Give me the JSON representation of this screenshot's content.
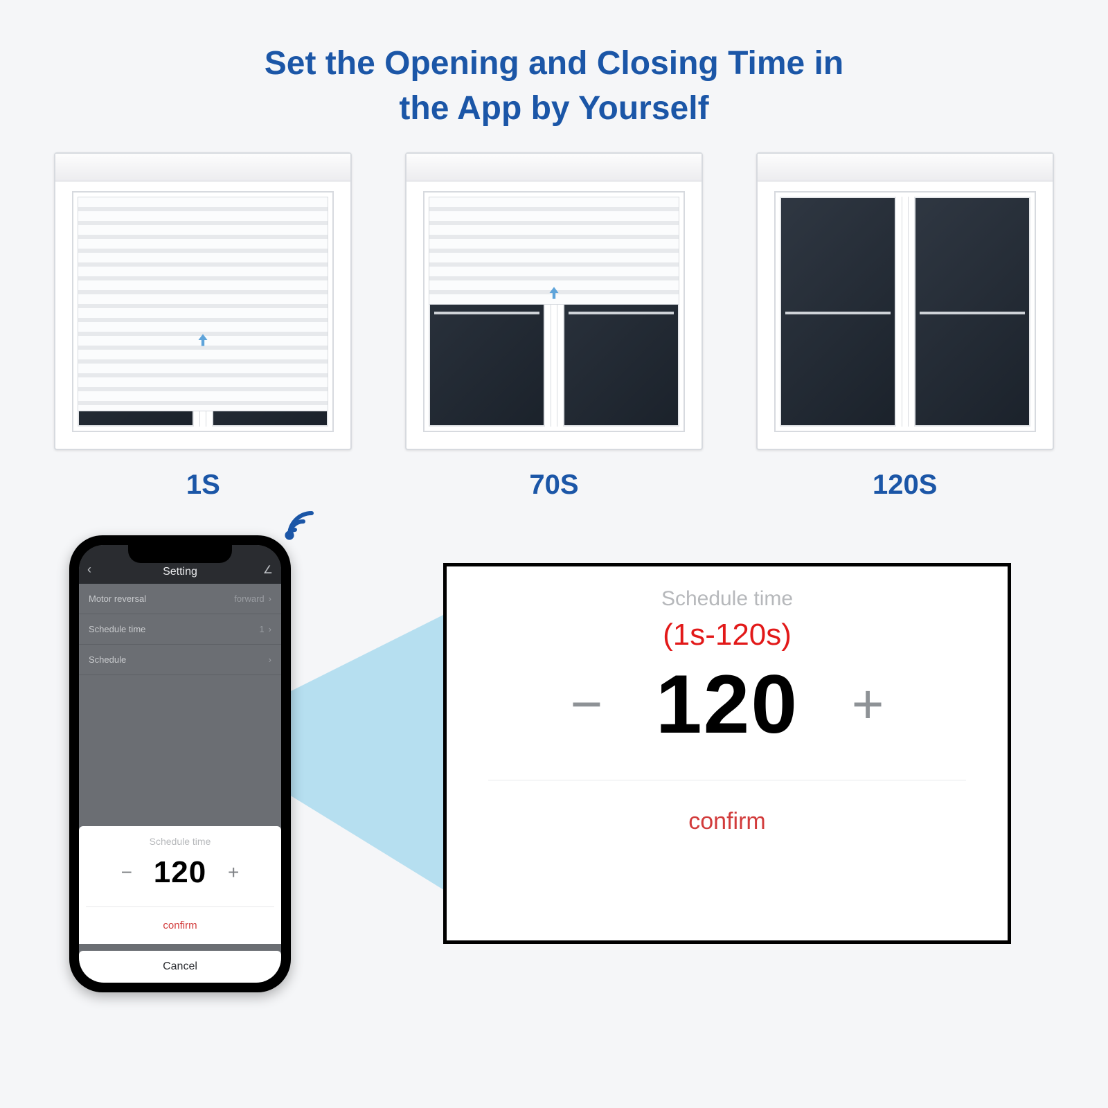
{
  "headline_line1": "Set the Opening and Closing Time in",
  "headline_line2": "the App by Yourself",
  "times": {
    "t1": "1S",
    "t2": "70S",
    "t3": "120S"
  },
  "phone": {
    "header": "Setting",
    "rows": {
      "motor_label": "Motor reversal",
      "motor_value": "forward",
      "schedtime_label": "Schedule time",
      "schedtime_value": "1",
      "schedule_label": "Schedule"
    },
    "modal": {
      "title": "Schedule time",
      "value": "120",
      "confirm": "confirm"
    },
    "cancel": "Cancel"
  },
  "popup": {
    "title": "Schedule time",
    "range": "(1s-120s)",
    "value": "120",
    "confirm": "confirm"
  }
}
